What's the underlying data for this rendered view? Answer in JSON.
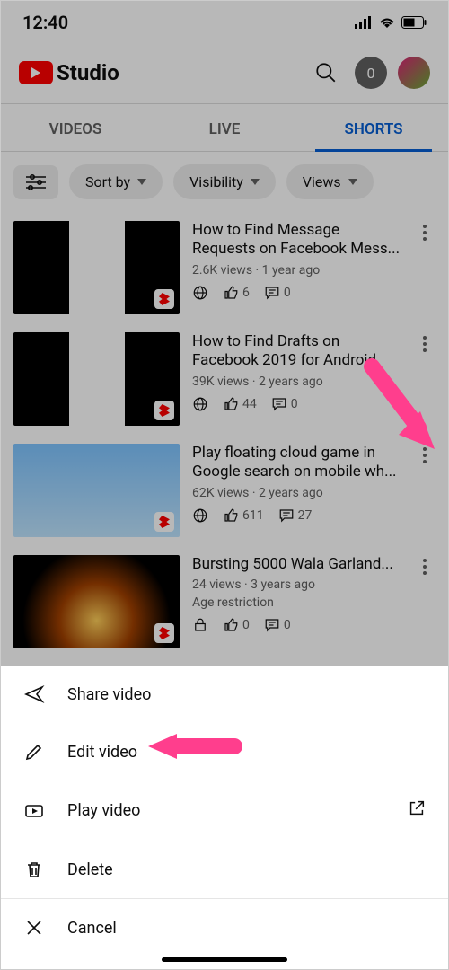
{
  "statusbar": {
    "time": "12:40"
  },
  "appbar": {
    "title": "Studio",
    "notif_count": "0"
  },
  "tabs": {
    "videos": "VIDEOS",
    "live": "LIVE",
    "shorts": "SHORTS"
  },
  "chips": {
    "sort": "Sort by",
    "visibility": "Visibility",
    "views": "Views"
  },
  "videos": [
    {
      "title": "How to Find Message Requests on Facebook Mess...",
      "stats": "2.6K views · 1 year ago",
      "likes": "6",
      "comments": "0",
      "restricted": false
    },
    {
      "title": "How to Find Drafts on Facebook 2019 for Android",
      "stats": "39K views · 2 years ago",
      "likes": "44",
      "comments": "0",
      "restricted": false
    },
    {
      "title": "Play floating cloud game in Google search on mobile wh...",
      "stats": "62K views · 2 years ago",
      "likes": "611",
      "comments": "27",
      "restricted": false
    },
    {
      "title": "Bursting 5000 Wala Garland...",
      "stats": "24 views · 3 years ago",
      "likes": "0",
      "comments": "0",
      "restricted": true,
      "restrict_label": "Age restriction"
    }
  ],
  "sheet": {
    "share": "Share video",
    "edit": "Edit video",
    "play": "Play video",
    "delete": "Delete",
    "cancel": "Cancel"
  }
}
